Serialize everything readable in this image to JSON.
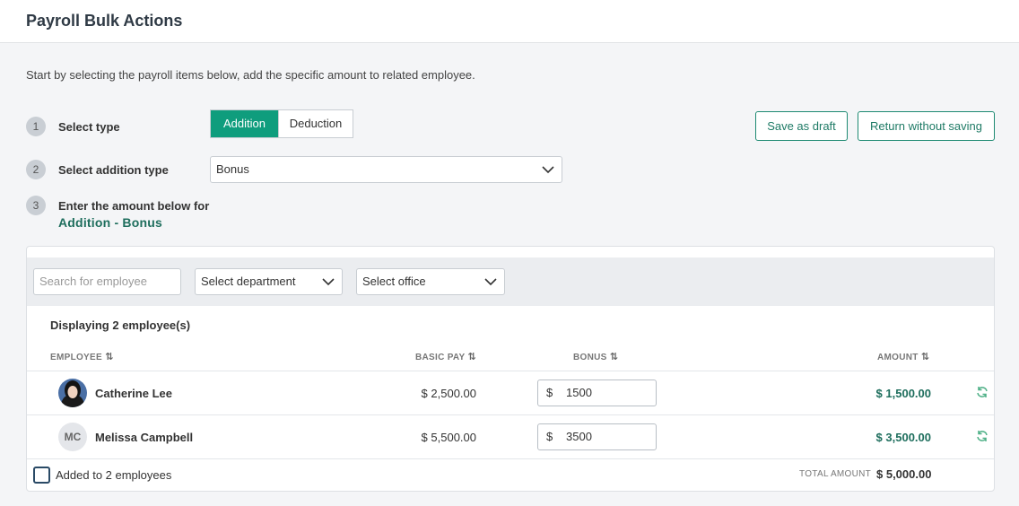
{
  "header": {
    "title": "Payroll Bulk Actions"
  },
  "intro": "Start by selecting the payroll items below, add the specific amount to related employee.",
  "steps": [
    {
      "num": "1",
      "label": "Select type"
    },
    {
      "num": "2",
      "label": "Select addition type"
    },
    {
      "num": "3",
      "label": "Enter the amount below for",
      "sub": "Addition - Bonus"
    }
  ],
  "type_toggle": {
    "options": [
      "Addition",
      "Deduction"
    ],
    "selected": "Addition"
  },
  "addition_type": {
    "value": "Bonus"
  },
  "actions": {
    "save_draft": "Save as draft",
    "return": "Return without saving"
  },
  "filters": {
    "search_placeholder": "Search for employee",
    "department": "Select department",
    "office": "Select office"
  },
  "table": {
    "count_text": "Displaying 2 employee(s)",
    "columns": [
      "EMPLOYEE",
      "BASIC PAY",
      "BONUS",
      "AMOUNT"
    ],
    "rows": [
      {
        "name": "Catherine Lee",
        "basic_pay": "$ 2,500.00",
        "currency": "$",
        "bonus": "1500",
        "amount": "$ 1,500.00"
      },
      {
        "name": "Melissa Campbell",
        "initials": "MC",
        "basic_pay": "$ 5,500.00",
        "currency": "$",
        "bonus": "3500",
        "amount": "$ 3,500.00"
      }
    ]
  },
  "footer": {
    "added_label": "Added to 2 employees",
    "total_label": "TOTAL AMOUNT",
    "total_value": "$ 5,000.00"
  },
  "colors": {
    "accent": "#0f9d7d",
    "amount_text": "#1e6e5d"
  },
  "icons": {
    "sort": "sort-icon",
    "reset": "refresh-icon",
    "dropdown": "chevron-down-icon"
  }
}
